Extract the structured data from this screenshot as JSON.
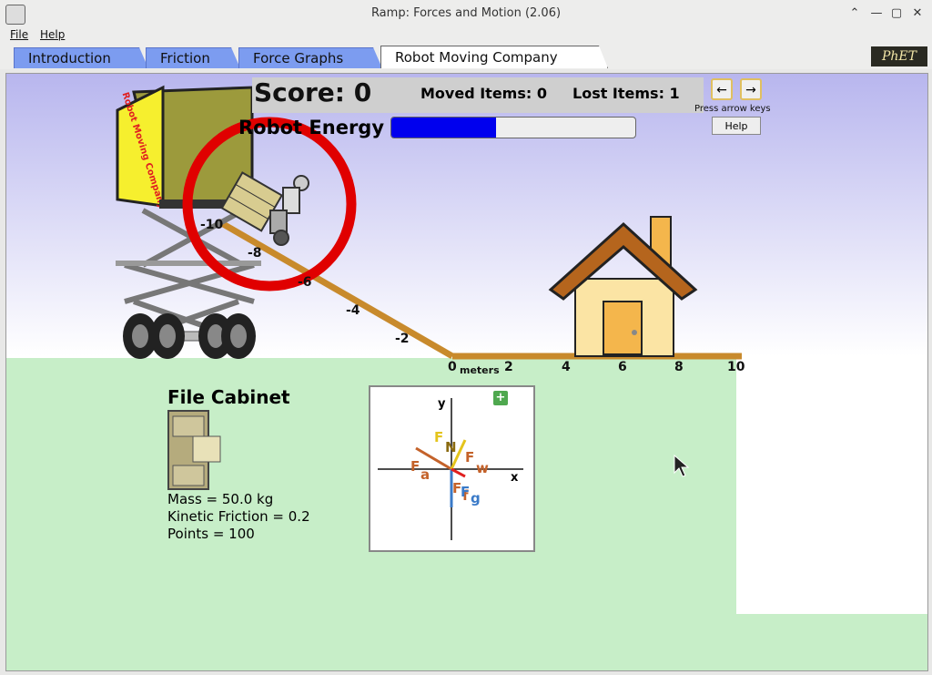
{
  "window": {
    "title": "Ramp: Forces and Motion (2.06)",
    "controls": [
      "⌃",
      "—",
      "▢",
      "✕"
    ]
  },
  "menu": {
    "file": "File",
    "help": "Help"
  },
  "tabs": [
    {
      "label": "Introduction"
    },
    {
      "label": "Friction"
    },
    {
      "label": "Force Graphs"
    },
    {
      "label": "Robot Moving Company"
    }
  ],
  "logo": "PhET",
  "game": {
    "score": "Score: 0",
    "moved": "Moved Items: 0",
    "lost": "Lost Items: 1",
    "energy_label": "Robot Energy",
    "energy_level": 0.43,
    "arrow_left": "←",
    "arrow_right": "→",
    "press_hint": "Press arrow keys",
    "help": "Help",
    "truck_text": "Robot Moving Company"
  },
  "ruler": {
    "ticks": [
      "-10",
      "-8",
      "-6",
      "-4",
      "-2",
      "0",
      "2",
      "4",
      "6",
      "8",
      "10"
    ],
    "unit": "meters"
  },
  "object": {
    "name": "File Cabinet",
    "mass": "Mass = 50.0 kg",
    "friction": "Kinetic Friction = 0.2",
    "points": "Points = 100"
  },
  "fbd": {
    "y": "y",
    "x": "x",
    "labels": {
      "f": "F",
      "n": "N",
      "fw": "F",
      "w": "w",
      "fa": "F",
      "a": "a",
      "ff": "F",
      "f2": "f",
      "fg": "F",
      "g": "g"
    },
    "plus": "+"
  },
  "colors": {
    "ramp": "#c88a2c",
    "ground": "#c7eec8",
    "ring": "#e00000",
    "energy": "#0000ee"
  }
}
